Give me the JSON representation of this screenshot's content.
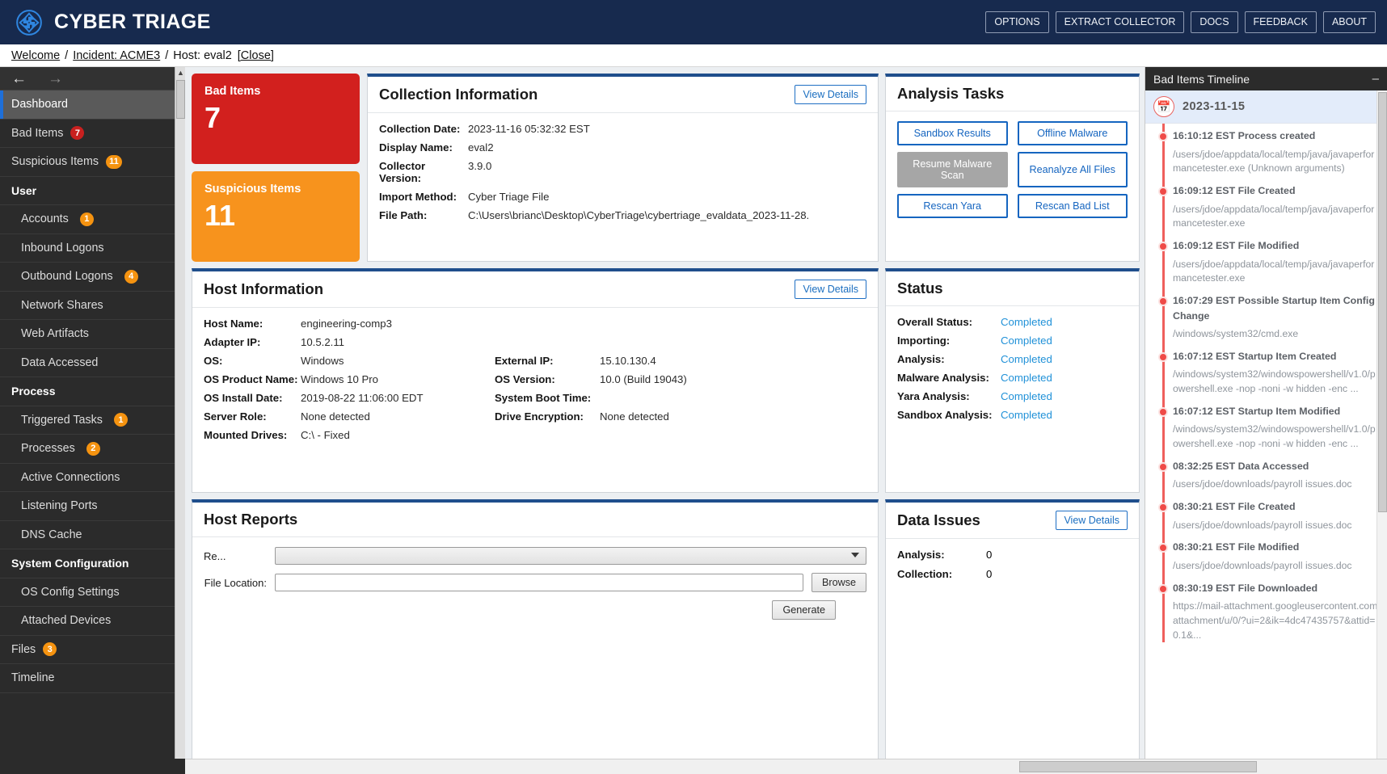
{
  "topbar": {
    "brand": "CYBER TRIAGE",
    "logo_icon": "recycle-hub-icon",
    "buttons": [
      {
        "label": "OPTIONS",
        "name": "options-button"
      },
      {
        "label": "EXTRACT COLLECTOR",
        "name": "extract-collector-button"
      },
      {
        "label": "DOCS",
        "name": "docs-button"
      },
      {
        "label": "FEEDBACK",
        "name": "feedback-button"
      },
      {
        "label": "ABOUT",
        "name": "about-button"
      }
    ]
  },
  "breadcrumb": {
    "welcome": "Welcome",
    "sep": "/",
    "incident": "Incident: ACME3",
    "host": "Host: eval2",
    "close": "[Close]"
  },
  "sidebar": {
    "back_icon": "arrow-left-icon",
    "forward_icon": "arrow-right-icon",
    "items": [
      {
        "label": "Dashboard",
        "badge": "",
        "type": "item",
        "selected": true
      },
      {
        "label": "Bad Items",
        "badge": "7",
        "badge_color": "red",
        "type": "item"
      },
      {
        "label": "Suspicious Items",
        "badge": "11",
        "badge_color": "orange",
        "type": "item"
      },
      {
        "label": "User",
        "badge": "",
        "type": "group"
      },
      {
        "label": "Accounts",
        "badge": "1",
        "badge_color": "orange",
        "type": "sub"
      },
      {
        "label": "Inbound Logons",
        "badge": "",
        "type": "sub"
      },
      {
        "label": "Outbound Logons",
        "badge": "4",
        "badge_color": "orange",
        "type": "sub"
      },
      {
        "label": "Network Shares",
        "badge": "",
        "type": "sub"
      },
      {
        "label": "Web Artifacts",
        "badge": "",
        "type": "sub"
      },
      {
        "label": "Data Accessed",
        "badge": "",
        "type": "sub"
      },
      {
        "label": "Process",
        "badge": "",
        "type": "group"
      },
      {
        "label": "Triggered Tasks",
        "badge": "1",
        "badge_color": "orange",
        "type": "sub"
      },
      {
        "label": "Processes",
        "badge": "2",
        "badge_color": "orange",
        "type": "sub"
      },
      {
        "label": "Active Connections",
        "badge": "",
        "type": "sub"
      },
      {
        "label": "Listening Ports",
        "badge": "",
        "type": "sub"
      },
      {
        "label": "DNS Cache",
        "badge": "",
        "type": "sub"
      },
      {
        "label": "System Configuration",
        "badge": "",
        "type": "group"
      },
      {
        "label": "OS Config Settings",
        "badge": "",
        "type": "sub"
      },
      {
        "label": "Attached Devices",
        "badge": "",
        "type": "sub"
      },
      {
        "label": "Files",
        "badge": "3",
        "badge_color": "orange",
        "type": "item"
      },
      {
        "label": "Timeline",
        "badge": "",
        "type": "item"
      }
    ]
  },
  "tiles": [
    {
      "label": "Bad Items",
      "value": "7",
      "color": "#d2201e",
      "name": "bad-items-tile"
    },
    {
      "label": "Suspicious Items",
      "value": "11",
      "color": "#f7931d",
      "name": "suspicious-items-tile"
    }
  ],
  "collection_information": {
    "title": "Collection Information",
    "view_details": "View Details",
    "rows": [
      {
        "key": "Collection Date:",
        "value": "2023-11-16 05:32:32 EST"
      },
      {
        "key": "Display Name:",
        "value": "eval2"
      },
      {
        "key": "Collector Version:",
        "value": "3.9.0"
      },
      {
        "key": "Import Method:",
        "value": "Cyber Triage File"
      },
      {
        "key": "File Path:",
        "value": "C:\\Users\\brianc\\Desktop\\CyberTriage\\cybertriage_evaldata_2023-11-28."
      }
    ]
  },
  "analysis_tasks": {
    "title": "Analysis Tasks",
    "buttons": [
      {
        "label": "Sandbox Results",
        "disabled": false,
        "name": "sandbox-results-button"
      },
      {
        "label": "Offline Malware",
        "disabled": false,
        "name": "offline-malware-button"
      },
      {
        "label": "Resume Malware Scan",
        "disabled": true,
        "name": "resume-malware-scan-button"
      },
      {
        "label": "Reanalyze All Files",
        "disabled": false,
        "name": "reanalyze-all-files-button"
      },
      {
        "label": "Rescan Yara",
        "disabled": false,
        "name": "rescan-yara-button"
      },
      {
        "label": "Rescan Bad List",
        "disabled": false,
        "name": "rescan-bad-list-button"
      }
    ]
  },
  "host_information": {
    "title": "Host Information",
    "view_details": "View Details",
    "rows": [
      {
        "k1": "Host Name:",
        "v1": "engineering-comp3",
        "k2": "",
        "v2": ""
      },
      {
        "k1": "Adapter IP:",
        "v1": "10.5.2.11",
        "k2": "",
        "v2": ""
      },
      {
        "k1": "OS:",
        "v1": "Windows",
        "k2": "External IP:",
        "v2": "15.10.130.4"
      },
      {
        "k1": "OS Product Name:",
        "v1": "Windows 10 Pro",
        "k2": "OS Version:",
        "v2": "10.0 (Build 19043)"
      },
      {
        "k1": "OS Install Date:",
        "v1": "2019-08-22 11:06:00 EDT",
        "k2": "System Boot Time:",
        "v2": ""
      },
      {
        "k1": "Server Role:",
        "v1": "None detected",
        "k2": "Drive Encryption:",
        "v2": "None detected"
      },
      {
        "k1": "Mounted Drives:",
        "v1": "C:\\ - Fixed",
        "k2": "",
        "v2": ""
      }
    ]
  },
  "status": {
    "title": "Status",
    "rows": [
      {
        "key": "Overall Status:",
        "value": "Completed"
      },
      {
        "key": "Importing:",
        "value": "Completed"
      },
      {
        "key": "Analysis:",
        "value": "Completed"
      },
      {
        "key": "Malware Analysis:",
        "value": "Completed"
      },
      {
        "key": "Yara Analysis:",
        "value": "Completed"
      },
      {
        "key": "Sandbox Analysis:",
        "value": "Completed"
      }
    ],
    "link_color": "#2091d8"
  },
  "host_reports": {
    "title": "Host Reports",
    "report_label": "Re...",
    "report_value": "",
    "file_location_label": "File Location:",
    "file_location_value": "",
    "browse_label": "Browse",
    "generate_label": "Generate"
  },
  "data_issues": {
    "title": "Data Issues",
    "view_details": "View Details",
    "rows": [
      {
        "key": "Analysis:",
        "value": "0"
      },
      {
        "key": "Collection:",
        "value": "0"
      }
    ]
  },
  "timeline": {
    "title": "Bad Items Timeline",
    "minimize_icon": "minimize-icon",
    "calendar_icon": "calendar-icon",
    "date": "2023-11-15",
    "events": [
      {
        "title": "16:10:12 EST Process created",
        "desc": "/users/jdoe/appdata/local/temp/java/javaperformancetester.exe (Unknown arguments)"
      },
      {
        "title": "16:09:12 EST File Created",
        "desc": "/users/jdoe/appdata/local/temp/java/javaperformancetester.exe"
      },
      {
        "title": "16:09:12 EST File Modified",
        "desc": "/users/jdoe/appdata/local/temp/java/javaperformancetester.exe"
      },
      {
        "title": "16:07:29 EST Possible Startup Item Config Change",
        "desc": "/windows/system32/cmd.exe"
      },
      {
        "title": "16:07:12 EST Startup Item Created",
        "desc": "/windows/system32/windowspowershell/v1.0/powershell.exe -nop -noni -w hidden -enc ..."
      },
      {
        "title": "16:07:12 EST Startup Item Modified",
        "desc": "/windows/system32/windowspowershell/v1.0/powershell.exe -nop -noni -w hidden -enc ..."
      },
      {
        "title": "08:32:25 EST Data Accessed",
        "desc": "/users/jdoe/downloads/payroll issues.doc"
      },
      {
        "title": "08:30:21 EST File Created",
        "desc": "/users/jdoe/downloads/payroll issues.doc"
      },
      {
        "title": "08:30:21 EST File Modified",
        "desc": "/users/jdoe/downloads/payroll issues.doc"
      },
      {
        "title": "08:30:19 EST File Downloaded",
        "desc": "https://mail-attachment.googleusercontent.com/attachment/u/0/?ui=2&ik=4dc47435757&attid=0.1&..."
      }
    ]
  }
}
